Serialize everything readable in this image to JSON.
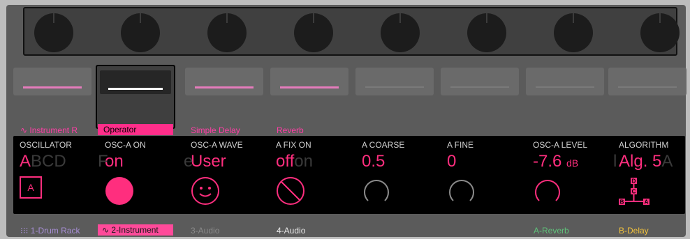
{
  "tracks": {
    "labels": [
      "Instrument R",
      "Operator",
      "Simple Delay",
      "Reverb"
    ],
    "bottom": [
      "1-Drum Rack",
      "2-Instrument",
      "3-Audio",
      "4-Audio",
      "A-Reverb",
      "B-Delay"
    ]
  },
  "params": [
    {
      "label": "OSCILLATOR",
      "value": "A",
      "value_dim": "BCD",
      "icon": "A"
    },
    {
      "label": "OSC-A ON",
      "value": "on",
      "prev": "F"
    },
    {
      "label": "OSC-A WAVE",
      "value": "User",
      "prev": "e"
    },
    {
      "label": "A FIX ON",
      "value": "off",
      "value_dim": "on"
    },
    {
      "label": "A COARSE",
      "value": "0.5"
    },
    {
      "label": "A FINE",
      "value": "0"
    },
    {
      "label": "OSC-A LEVEL",
      "value": "-7.6",
      "unit": "dB"
    },
    {
      "label": "ALGORITHM",
      "value": "Alg. 5",
      "value_dim": "A",
      "prev": "l"
    }
  ],
  "algorithm_ops": [
    "D",
    "C",
    "B",
    "A"
  ],
  "colors": {
    "accent": "#ff2e7e",
    "bg": "#5b5b5b",
    "display": "#000000"
  }
}
